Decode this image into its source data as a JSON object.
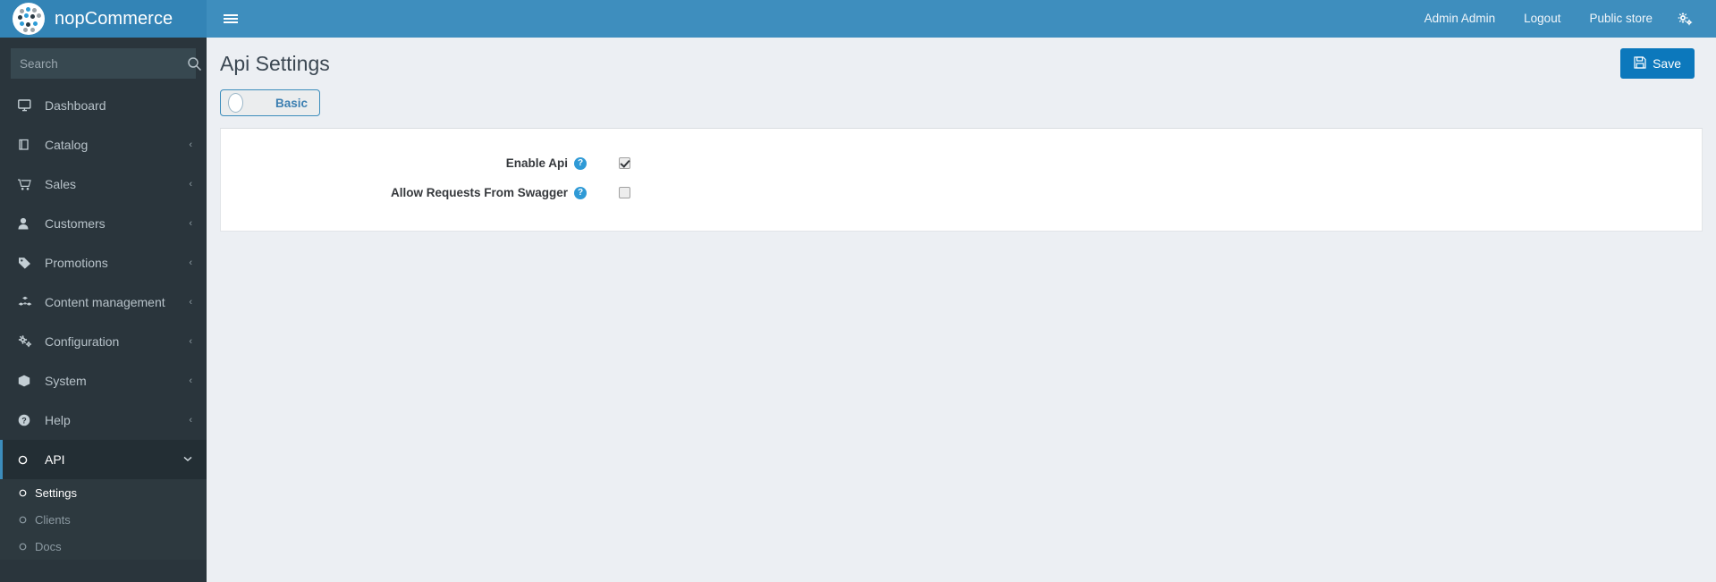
{
  "app": {
    "brand": "nopCommerce",
    "menu_toggle_icon": "hamburger-icon"
  },
  "topbar": {
    "user": "Admin Admin",
    "logout": "Logout",
    "public_store": "Public store",
    "settings_icon": "gear-icon"
  },
  "sidebar": {
    "search": {
      "placeholder": "Search",
      "value": "",
      "icon": "search-icon"
    },
    "items": [
      {
        "label": "Dashboard",
        "icon": "monitor-icon",
        "caret": "",
        "active": false
      },
      {
        "label": "Catalog",
        "icon": "book-icon",
        "caret": "‹",
        "active": false
      },
      {
        "label": "Sales",
        "icon": "cart-icon",
        "caret": "‹",
        "active": false
      },
      {
        "label": "Customers",
        "icon": "user-icon",
        "caret": "‹",
        "active": false
      },
      {
        "label": "Promotions",
        "icon": "tag-icon",
        "caret": "‹",
        "active": false
      },
      {
        "label": "Content management",
        "icon": "cubes-icon",
        "caret": "‹",
        "active": false
      },
      {
        "label": "Configuration",
        "icon": "cogs-icon",
        "caret": "‹",
        "active": false
      },
      {
        "label": "System",
        "icon": "cube-icon",
        "caret": "‹",
        "active": false
      },
      {
        "label": "Help",
        "icon": "question-circle-icon",
        "caret": "‹",
        "active": false
      },
      {
        "label": "API",
        "icon": "circle-o-icon",
        "caret": "⌄",
        "active": true
      }
    ],
    "submenu": [
      {
        "label": "Settings",
        "icon": "circle-o-icon",
        "active": true
      },
      {
        "label": "Clients",
        "icon": "circle-o-icon",
        "active": false
      },
      {
        "label": "Docs",
        "icon": "circle-o-icon",
        "active": false
      }
    ]
  },
  "main": {
    "title": "Api Settings",
    "save_label": "Save",
    "save_icon": "floppy-save-icon",
    "tabs": [
      {
        "label": "Basic",
        "icon": "tab-circle-icon",
        "active": true
      }
    ],
    "form": {
      "rows": [
        {
          "label": "Enable Api",
          "help_icon": "question-mark-icon",
          "help_glyph": "?",
          "control": "checkbox",
          "checked": true
        },
        {
          "label": "Allow Requests From Swagger",
          "help_icon": "question-mark-icon",
          "help_glyph": "?",
          "control": "checkbox",
          "checked": false
        }
      ]
    }
  },
  "colors": {
    "header_blue": "#3e8ebe",
    "brand_blue": "#3384b6",
    "sidebar_dark": "#2a353c",
    "sidebar_active": "#232e34",
    "accent_blue": "#3c8dbc",
    "button_blue": "#0c78bc",
    "content_bg": "#eceff3",
    "help_icon_blue": "#2f9ad6"
  }
}
